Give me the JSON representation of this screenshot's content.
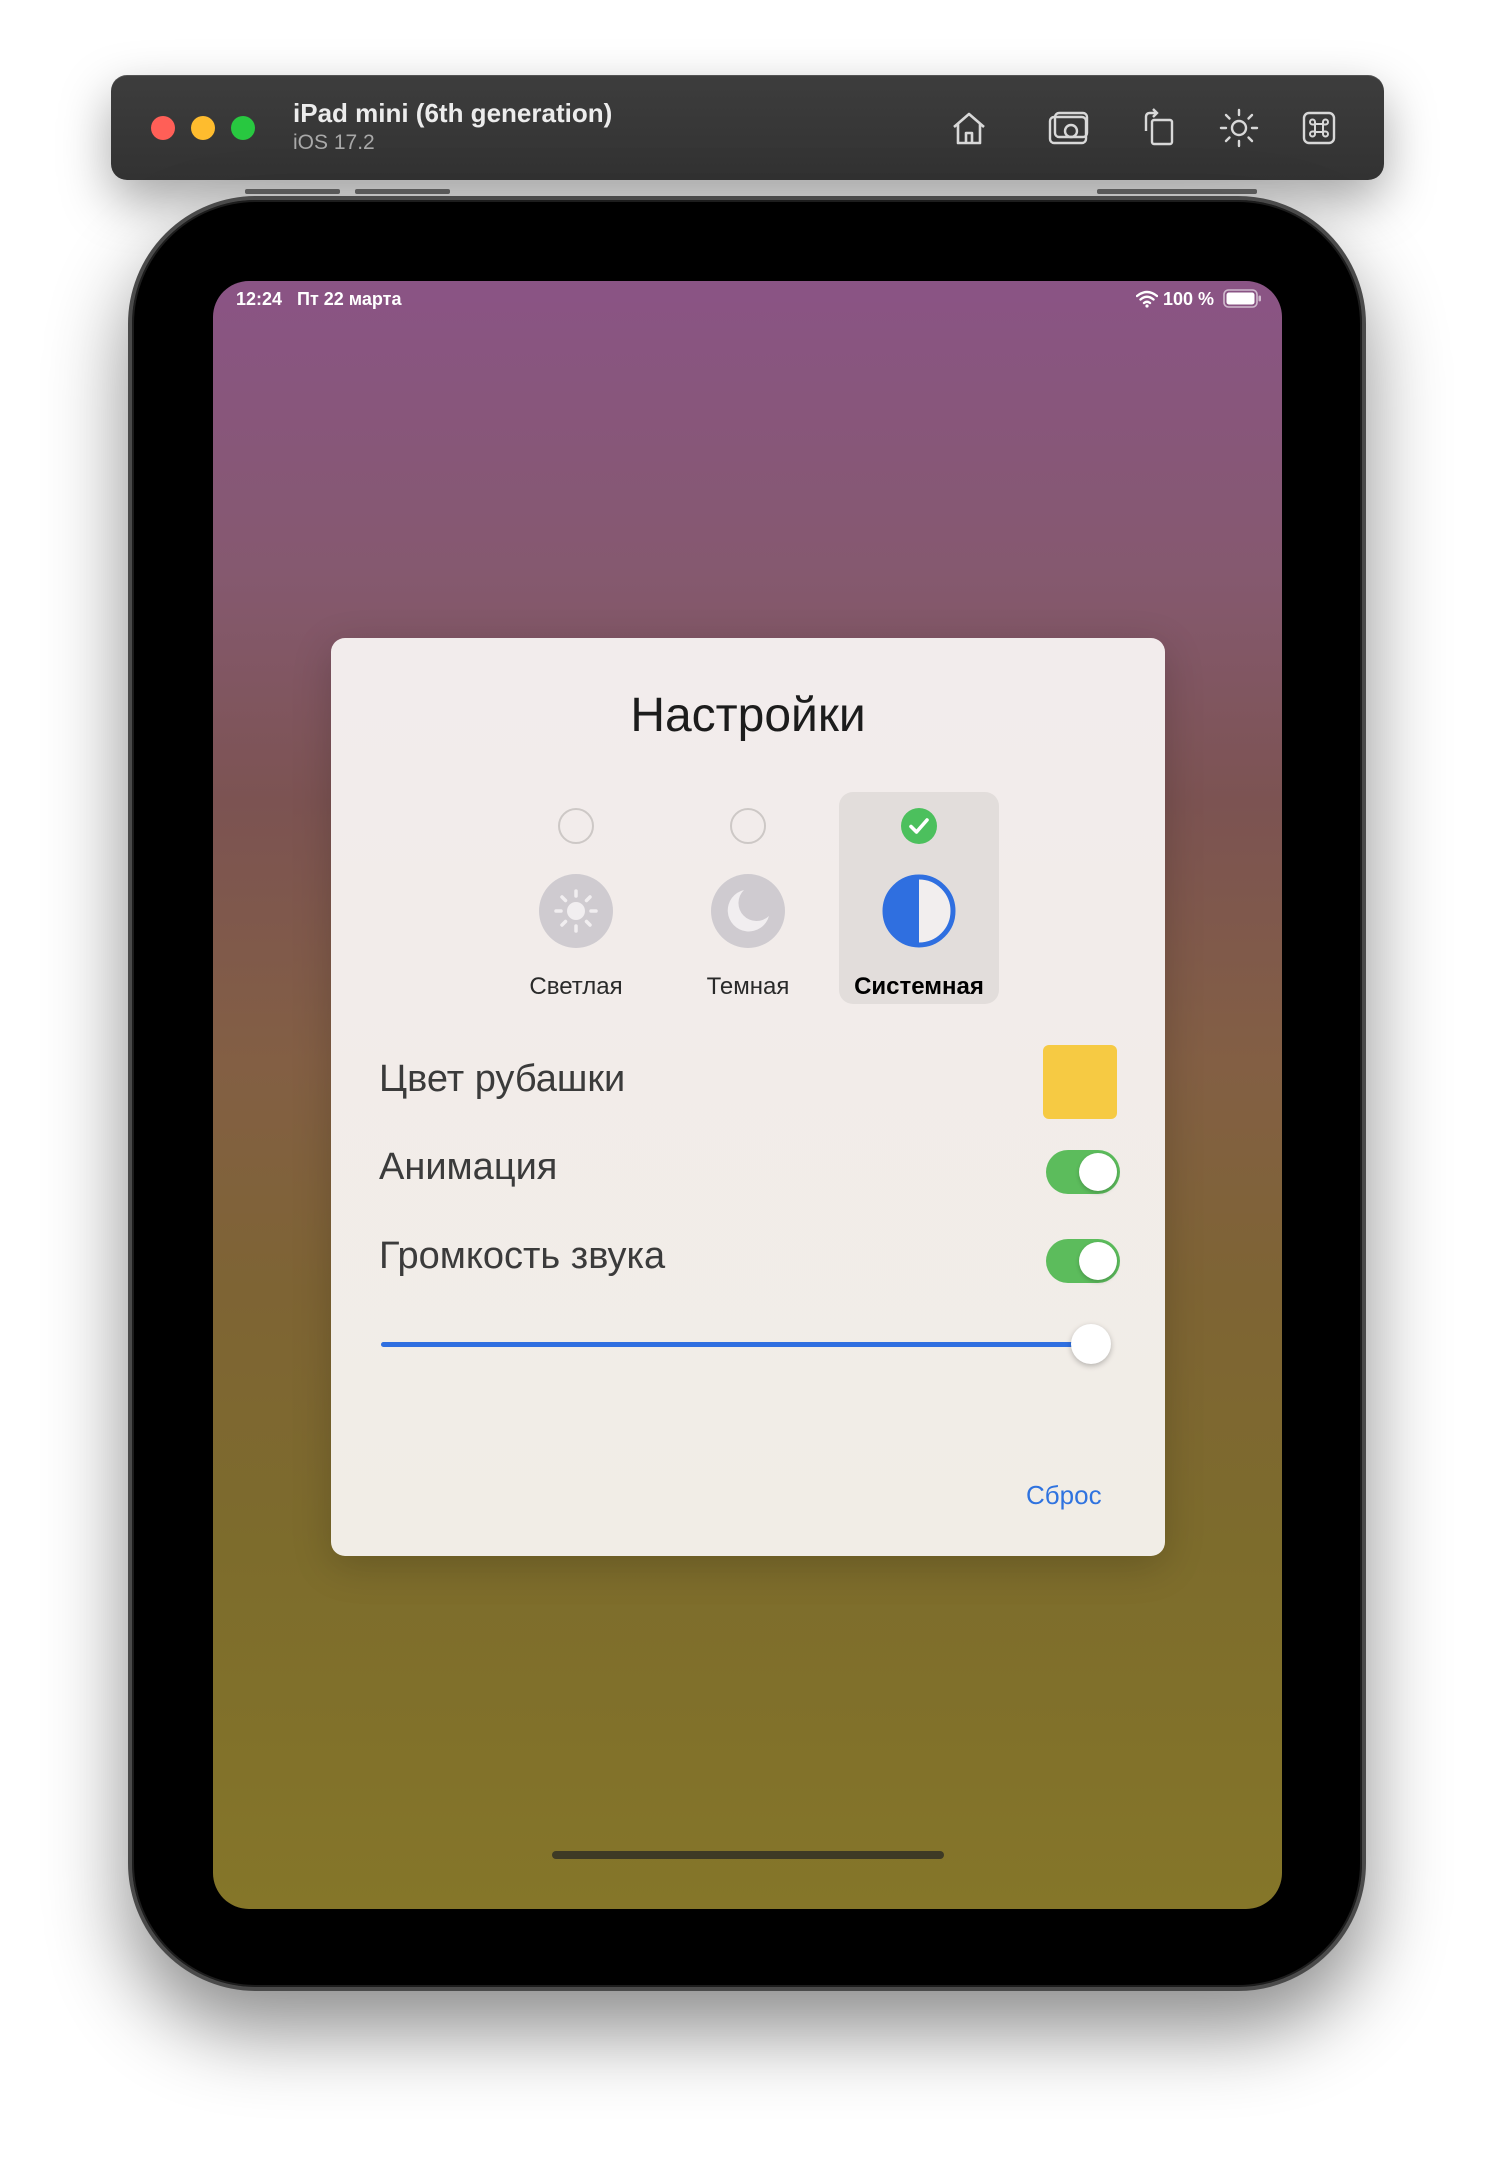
{
  "simulator": {
    "title": "iPad mini (6th generation)",
    "subtitle": "iOS 17.2",
    "tools": [
      "home-icon",
      "screenshot-icon",
      "rotate-icon",
      "appearance-icon",
      "keyboard-command-icon"
    ]
  },
  "status_bar": {
    "time": "12:24",
    "date": "Пт 22 марта",
    "battery": "100 %"
  },
  "settings": {
    "title": "Настройки",
    "themes": [
      {
        "label": "Светлая",
        "icon": "sun-icon",
        "selected": false
      },
      {
        "label": "Темная",
        "icon": "moon-icon",
        "selected": false
      },
      {
        "label": "Системная",
        "icon": "half-circle-icon",
        "selected": true
      }
    ],
    "shirt_color": {
      "label": "Цвет рубашки",
      "color": "#f6ca43"
    },
    "animation": {
      "label": "Анимация",
      "enabled": true
    },
    "sound": {
      "label": "Громкость звука",
      "enabled": true,
      "volume": 1.0
    },
    "reset_label": "Сброс"
  },
  "colors": {
    "accent": "#2f73df",
    "toggle_on": "#5cbc5c",
    "check": "#4cc05d"
  }
}
